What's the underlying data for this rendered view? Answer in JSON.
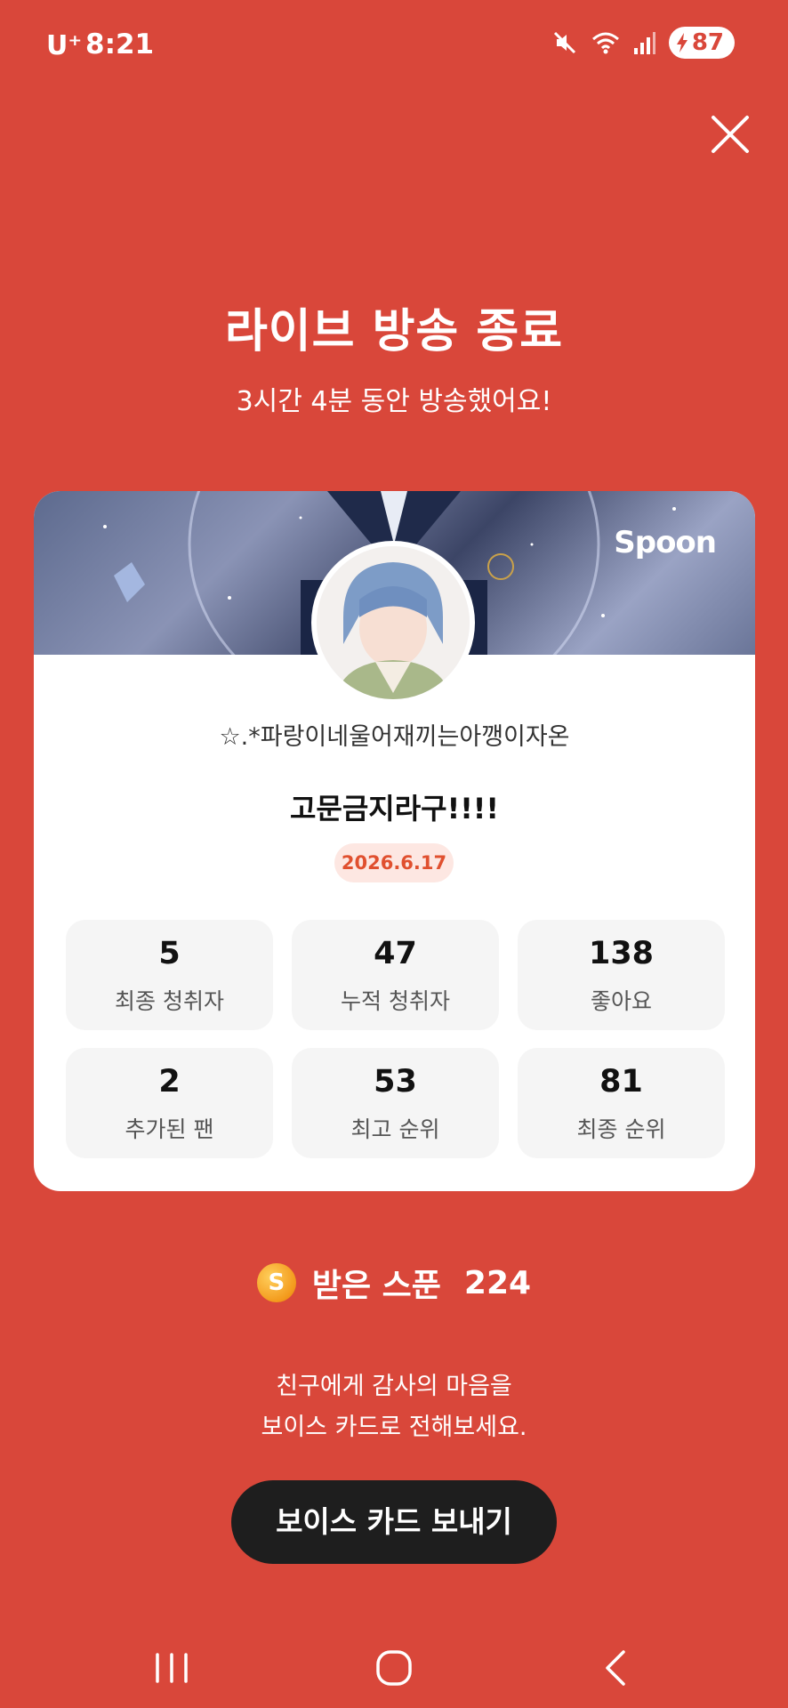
{
  "status_bar": {
    "carrier": "U⁺",
    "time": "8:21",
    "battery": "87"
  },
  "header": {
    "title": "라이브 방송 종료",
    "subtitle": "3시간 4분 동안 방송했어요!"
  },
  "card": {
    "brand": "Spoon",
    "nickname": "☆.*파랑이네울어재끼는아깽이자온",
    "live_title": "고문금지라구!!!!",
    "date": "2026.6.17",
    "stats": [
      {
        "value": "5",
        "label": "최종 청취자"
      },
      {
        "value": "47",
        "label": "누적 청취자"
      },
      {
        "value": "138",
        "label": "좋아요"
      },
      {
        "value": "2",
        "label": "추가된 팬"
      },
      {
        "value": "53",
        "label": "최고 순위"
      },
      {
        "value": "81",
        "label": "최종 순위"
      }
    ]
  },
  "spoons": {
    "coin_letter": "S",
    "label": "받은 스푼",
    "count": "224"
  },
  "thanks": {
    "line1": "친구에게 감사의 마음을",
    "line2": "보이스 카드로 전해보세요."
  },
  "send_button": "보이스 카드 보내기",
  "colors": {
    "background": "#D9473A",
    "date_badge_bg": "#FDE7E2",
    "date_badge_text": "#E0502F",
    "button_bg": "#1E1E1E"
  }
}
